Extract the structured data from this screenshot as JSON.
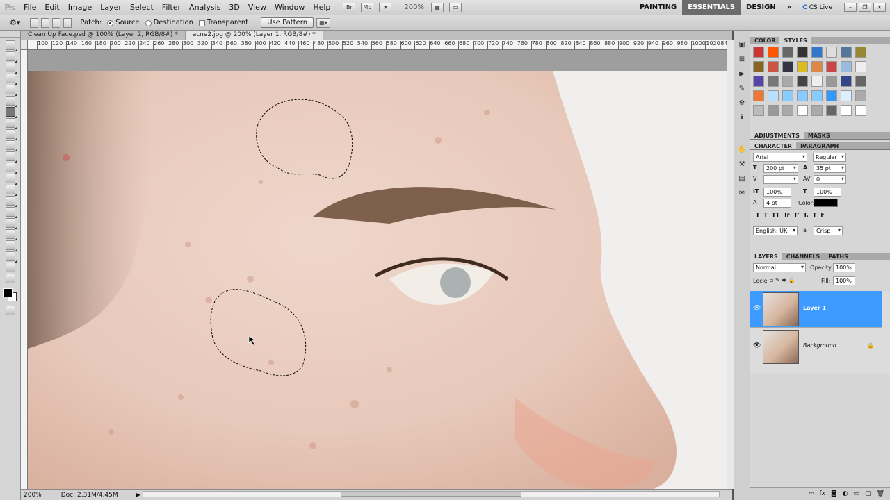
{
  "app": {
    "logo": "Ps"
  },
  "menu": [
    "File",
    "Edit",
    "Image",
    "Layer",
    "Select",
    "Filter",
    "Analysis",
    "3D",
    "View",
    "Window",
    "Help"
  ],
  "menubar": {
    "zoom": "200%",
    "workspaces": [
      "PAINTING",
      "ESSENTIALS",
      "DESIGN"
    ],
    "more": "»",
    "cslive": "CS Live"
  },
  "options": {
    "tool_label": "Patch:",
    "source_label": "Source",
    "destination_label": "Destination",
    "transparent_label": "Transparent",
    "use_pattern_label": "Use Pattern"
  },
  "documents": [
    {
      "title": "Clean Up Face.psd @ 100% (Layer 2, RGB/8#) *"
    },
    {
      "title": "acne2.jpg @ 200% (Layer 1, RGB/8#) *"
    }
  ],
  "ruler_ticks": [
    "100",
    "120",
    "140",
    "160",
    "180",
    "200",
    "220",
    "240",
    "260",
    "280",
    "300",
    "320",
    "340",
    "360",
    "380",
    "400",
    "420",
    "440",
    "460",
    "480",
    "500",
    "520",
    "540",
    "560",
    "580",
    "600",
    "620",
    "640",
    "660",
    "680",
    "700",
    "720",
    "740",
    "760",
    "780",
    "800",
    "820",
    "840",
    "860",
    "880",
    "900",
    "920",
    "940",
    "960",
    "980",
    "1000",
    "1020",
    "84"
  ],
  "status": {
    "zoom": "200%",
    "doc": "Doc: 2.31M/4.45M"
  },
  "panels": {
    "color_tab": "COLOR",
    "styles_tab": "STYLES",
    "adjustments_tab": "ADJUSTMENTS",
    "masks_tab": "MASKS",
    "character_tab": "CHARACTER",
    "paragraph_tab": "PARAGRAPH",
    "layers_tab": "LAYERS",
    "channels_tab": "CHANNELS",
    "paths_tab": "PATHS",
    "swatch_colors": [
      "#cc3333",
      "#ff5500",
      "#666666",
      "#333333",
      "#3377cc",
      "#dddddd",
      "#557799",
      "#998833",
      "#886622",
      "#cc5544",
      "#333344",
      "#ddbb22",
      "#dd8844",
      "#cc4444",
      "#99bbdd",
      "#eeeeee",
      "#5544aa",
      "#777777",
      "#aaaaaa",
      "#444444",
      "#eeeeee",
      "#999999",
      "#334488",
      "#666666",
      "#ee7733",
      "#bbddff",
      "#88ccff",
      "#88ccff",
      "#88ccff",
      "#3399ff",
      "#ddeeff",
      "#aaaaaa",
      "#bbbbbb",
      "#999999",
      "#aaaaaa",
      "#ffffff",
      "#aaaaaa",
      "#666666",
      "#ffffff",
      "#ffffff"
    ]
  },
  "character": {
    "font_family": "Arial",
    "font_style": "Regular",
    "size": "200 pt",
    "leading": "35 pt",
    "tracking": "0",
    "vscale": "100%",
    "hscale": "100%",
    "baseline": "4 pt",
    "color_label": "Color:",
    "language": "English: UK",
    "aa_label": "a",
    "antialias": "Crisp",
    "style_buttons": [
      "T",
      "T",
      "TT",
      "Tr",
      "T'",
      "T,",
      "T",
      "F"
    ]
  },
  "layers": {
    "blend_mode": "Normal",
    "opacity_label": "Opacity:",
    "opacity": "100%",
    "lock_label": "Lock:",
    "fill_label": "Fill:",
    "fill": "100%",
    "items": [
      {
        "name": "Layer 1",
        "active": true
      },
      {
        "name": "Background",
        "active": false
      }
    ]
  }
}
